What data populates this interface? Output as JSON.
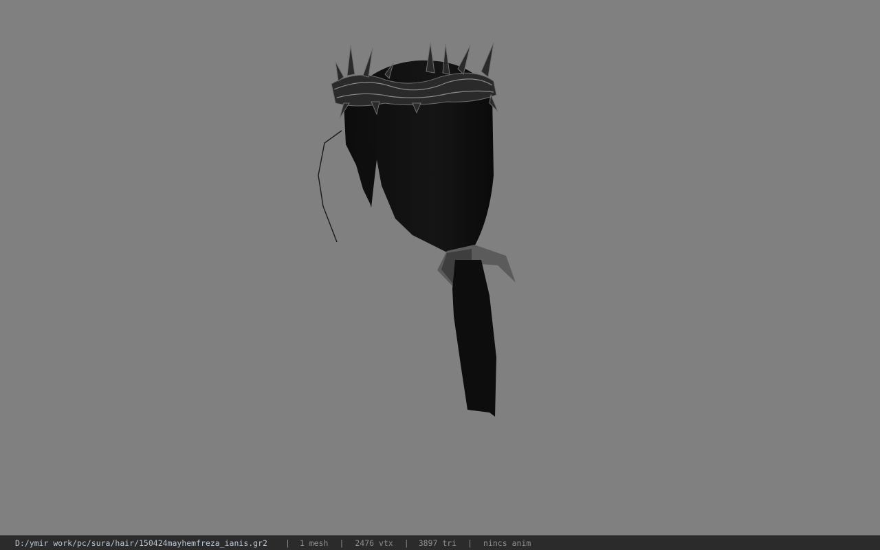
{
  "status_bar": {
    "file_path": "D:/ymir work/pc/sura/hair/150424mayhemfreza_ianis.gr2",
    "separator": "|",
    "mesh_count": "1 mesh",
    "vertex_count": "2476 vtx",
    "triangle_count": "3897 tri",
    "animation": "nincs anim"
  },
  "viewport": {
    "background_color": "#808080",
    "model": "hair-mesh-with-thorn-crown"
  }
}
